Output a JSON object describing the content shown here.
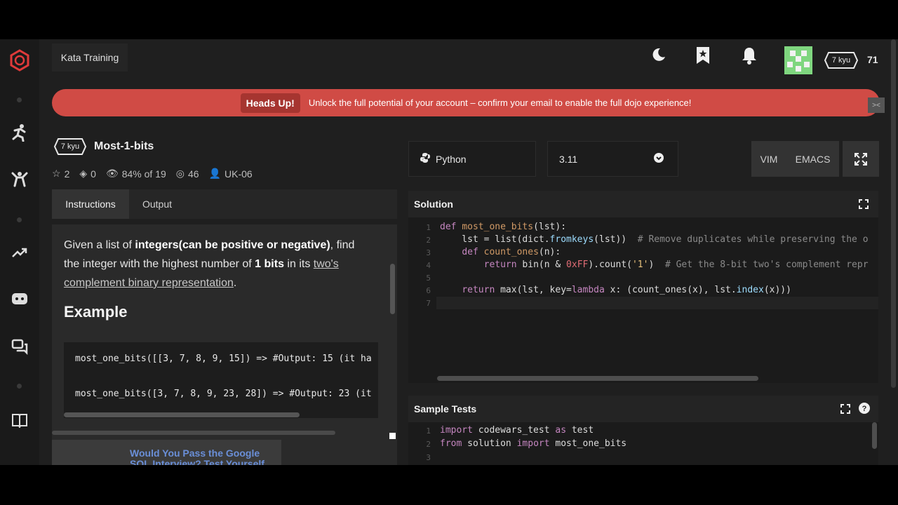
{
  "topbar": {
    "breadcrumb": "Kata Training",
    "user_rank": "7 kyu",
    "honor": "71"
  },
  "banner": {
    "label": "Heads Up!",
    "message": "Unlock the full potential of your account – confirm your email to enable the full dojo experience!"
  },
  "kata": {
    "rank": "7 kyu",
    "title": "Most-1-bits",
    "stats": {
      "stars": "2",
      "collections": "0",
      "satisfaction": "84% of 19",
      "completed": "46",
      "author": "UK-06"
    }
  },
  "tabs": [
    {
      "label": "Instructions",
      "active": true
    },
    {
      "label": "Output",
      "active": false
    }
  ],
  "instructions": {
    "p1": "Given a list of ",
    "p1_bold": "integers(can be positive or negative)",
    "p2": ", find the integer with the highest number of ",
    "p2_bold": "1 bits",
    "p3": " in its ",
    "link": "two's complement binary representation",
    "p4": ".",
    "example_heading": "Example",
    "example_lines": [
      "most_one_bits([[3, 7, 8, 9, 15]) => #Output: 15 (it ha",
      "most_one_bits([3, 7, 8, 9, 23, 28]) => #Output: 23 (it"
    ],
    "promo": "Would You Pass the Google SQL Interview? Test Yourself"
  },
  "editor": {
    "language": "Python",
    "version": "3.11",
    "modes": [
      "VIM",
      "EMACS"
    ],
    "solution_title": "Solution",
    "solution_line_numbers": [
      "1",
      "2",
      "3",
      "4",
      "5",
      "6",
      "7"
    ],
    "tests_title": "Sample Tests",
    "tests_line_numbers": [
      "1",
      "2",
      "3"
    ]
  },
  "colors": {
    "banner": "#d04b45",
    "background": "#1f1f1f",
    "brand": "#e03a3a"
  }
}
